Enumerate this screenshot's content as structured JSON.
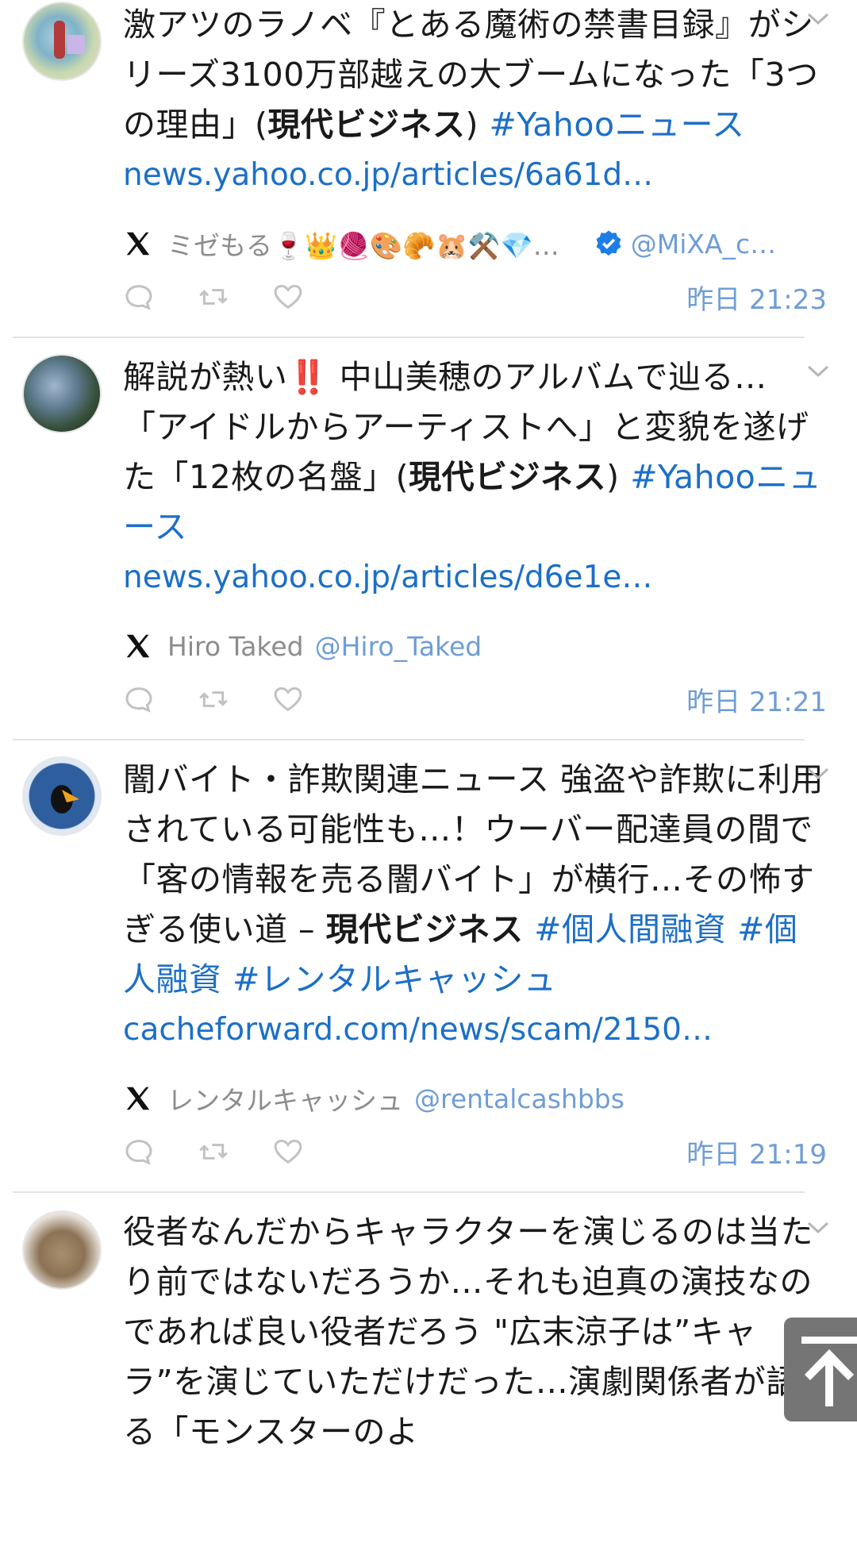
{
  "posts": [
    {
      "text_before": "激アツのラノベ『とある魔術の禁書目録』がシリーズ3100万部越えの大ブームになった「3つの理由」(",
      "bold": "現代ビジネス",
      "text_after": ")",
      "hashtags": "#Yahooニュース",
      "link": "news.yahoo.co.jp/articles/6a61d…",
      "author": "ミゼもる🍷👑🧶🎨🥐🐹⚒️💎…",
      "handle": "@MiXA_c…",
      "verified": true,
      "time": "昨日 21:23"
    },
    {
      "text_before": "解説が熱い‼️ 中山美穂のアルバムで辿る…「アイドルからアーティストへ」と変貌を遂げた「12枚の名盤」(",
      "bold": "現代ビジネス",
      "text_after": ") ",
      "hashtags": "#Yahooニュース",
      "link": "news.yahoo.co.jp/articles/d6e1e…",
      "author": "Hiro Taked",
      "handle": "@Hiro_Taked",
      "verified": false,
      "time": "昨日 21:21"
    },
    {
      "text_before": "闇バイト・詐欺関連ニュース 強盗や詐欺に利用されている可能性も…！ウーバー配達員の間で「客の情報を売る闇バイト」が横行…その怖すぎる使い道 – ",
      "bold": "現代ビジネス",
      "text_after": " ",
      "hashtags": "#個人間融資 #個人融資 #レンタルキャッシュ",
      "link": "cacheforward.com/news/scam/2150…",
      "author": "レンタルキャッシュ",
      "handle": "@rentalcashbbs",
      "verified": false,
      "time": "昨日 21:19"
    },
    {
      "text_before": "役者なんだからキャラクターを演じるのは当たり前ではないだろうか…それも迫真の演技なのであれば良い役者だろう \"広末涼子は”キャラ”を演じていただけだった…演劇関係者が語る「モンスターのよ",
      "bold": "",
      "text_after": "",
      "hashtags": "",
      "link": "",
      "author": "",
      "handle": "",
      "verified": false,
      "time": ""
    }
  ],
  "colors": {
    "link": "#1c6fc8",
    "handle": "#6f9dd6",
    "verified": "#1d7ee8",
    "scroll_button": "#757575"
  },
  "icons": [
    "x-logo-icon",
    "reply-icon",
    "retweet-icon",
    "like-icon",
    "chevron-down-icon",
    "verified-badge-icon",
    "arrow-up-icon"
  ]
}
